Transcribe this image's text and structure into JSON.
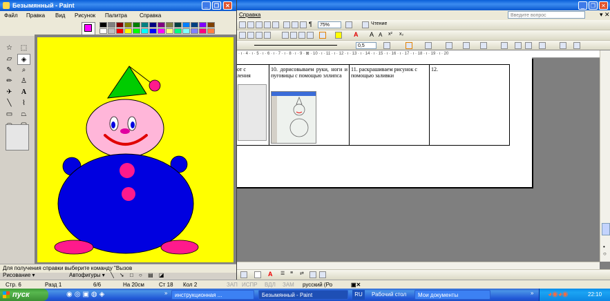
{
  "paint": {
    "title": "Безымянный - Paint",
    "menu": [
      "Файл",
      "Правка",
      "Вид",
      "Рисунок",
      "Палитра",
      "Справка"
    ],
    "palette_top": [
      "#000000",
      "#808080",
      "#800000",
      "#808000",
      "#008000",
      "#008080",
      "#000080",
      "#800080",
      "#808040",
      "#004040",
      "#0080ff",
      "#004080",
      "#8000ff",
      "#804000"
    ],
    "palette_bottom": [
      "#ffffff",
      "#c0c0c0",
      "#ff0000",
      "#ffff00",
      "#00ff00",
      "#00ffff",
      "#0000ff",
      "#ff00ff",
      "#ffff80",
      "#00ff80",
      "#80ffff",
      "#8080ff",
      "#ff0080",
      "#ff8040"
    ],
    "foreground_color": "#ff00ff",
    "canvas_bg": "#ffff00",
    "status": "Для получения справки выберите команду \"Вызов"
  },
  "word": {
    "menu_help": "Справка",
    "help_placeholder": "Введите вопрос",
    "zoom": "75%",
    "reading_button": "Чтение",
    "line_width": "0,5",
    "ruler_text": "3 · ı · 4 · ı · 5 · ı · 6 · ı · 7 · ı · 8 · ı · 9 · ⊠ · 10 · ı · 11 · ı · 12 · ı · 13 · ı · 14 · ı · 15 · ı · 16 · ı · 17 · ı · 18 · ı · 19 · ı · 20",
    "table": {
      "cell_left": "от с\nления",
      "cell_10": "10.    дорисовываем руки, ноги и пуговицы с помощью эллипса",
      "cell_11": "11.      раскрашиваем рисунок с помощью заливки",
      "cell_12": "12."
    },
    "drawing_label": "Рисование",
    "autoshapes_label": "Автофигуры"
  },
  "statusbar": {
    "page": "Стр. 6",
    "section": "Разд 1",
    "pages": "6/6",
    "at": "На 20см",
    "line": "Ст 18",
    "col": "Кол 2",
    "rec": "ЗАП",
    "trk": "ИСПР",
    "ext": "ВДЛ",
    "ovr": "ЗАМ",
    "language": "русский (Ро"
  },
  "taskbar": {
    "start": "пуск",
    "tasks": [
      "инструкционная ...",
      "Безымянный - Paint",
      "Рабочий стол",
      "Мои документы"
    ],
    "lang": "RU",
    "time": "22:10"
  },
  "colors": {
    "clown_hat": "#00cc00",
    "clown_face": "#ffb6d9",
    "clown_body": "#0000e0",
    "clown_buttons": "#ff1a8c",
    "clown_mouth": "#e00000"
  }
}
